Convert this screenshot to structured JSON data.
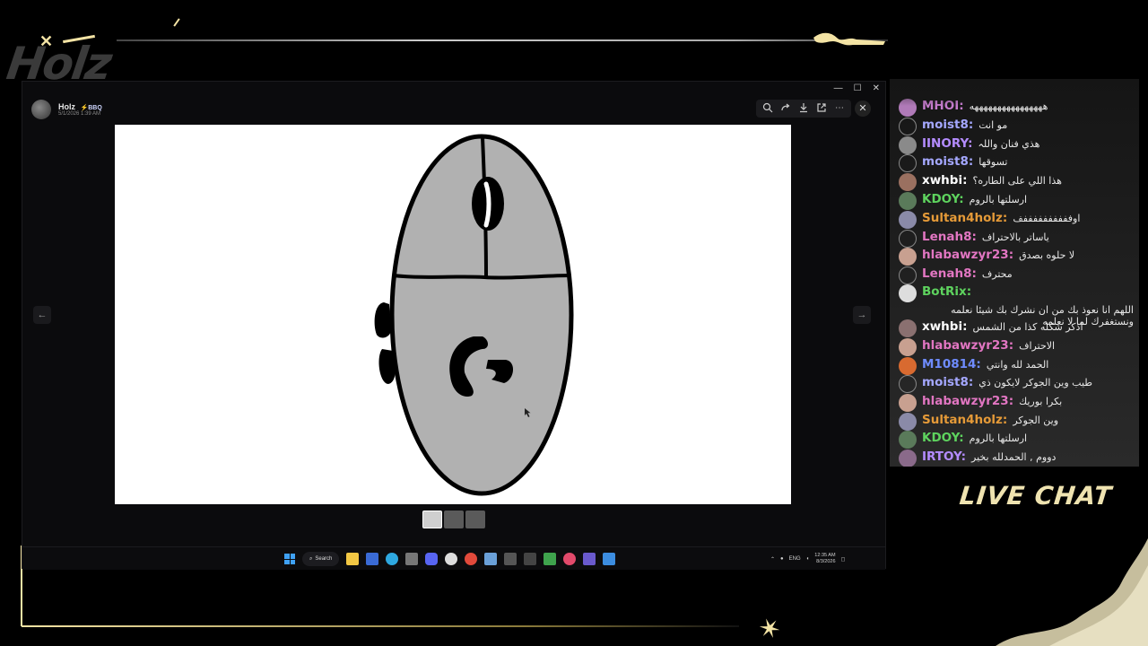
{
  "overlay": {
    "logo_text": "Holz",
    "live_chat_label": "LIVE CHAT",
    "accent_color": "#f3e3a4"
  },
  "window_controls": [
    "—",
    "☐",
    "✕"
  ],
  "viewer": {
    "author": "Holz",
    "author_badge": "⚡BBQ",
    "date": "5/1/2026 1:39 AM",
    "tools": [
      "zoom-in-icon",
      "forward-icon",
      "download-icon",
      "external-link-icon",
      "more-icon"
    ],
    "close_glyph": "✕",
    "prev_glyph": "←",
    "next_glyph": "→",
    "image_description": "hand-drawn computer mouse",
    "thumbnails": 3,
    "selected_thumbnail": 0
  },
  "taskbar": {
    "search_label": "Search",
    "language": "ENG",
    "time": "12:35 AM",
    "date": "8/3/2026"
  },
  "chat": {
    "messages": [
      {
        "user": "MHOI:",
        "color": "#c77dcf",
        "text": "ههههههههههههههههه"
      },
      {
        "user": "moist8:",
        "color": "#a4a7ff",
        "text": "مو انت"
      },
      {
        "user": "IINORY:",
        "color": "#b48cff",
        "text": "هذي فنان واللہ"
      },
      {
        "user": "moist8:",
        "color": "#a4a7ff",
        "text": "تسوقها"
      },
      {
        "user": "xwhbi:",
        "color": "#ffffff",
        "text": "هذا اللي على الطاره؟"
      },
      {
        "user": "KDOY:",
        "color": "#5ed35e",
        "text": "ارسلتها بالروم"
      },
      {
        "user": "Sultan4holz:",
        "color": "#e59a38",
        "text": "اوففففففففففف"
      },
      {
        "user": "Lenah8:",
        "color": "#e276c2",
        "text": "ياساتر بالاحتراف"
      },
      {
        "user": "hlabawzyr23:",
        "color": "#e276c2",
        "text": "لا حلوه بصدق"
      },
      {
        "user": "Lenah8:",
        "color": "#e276c2",
        "text": "محترف"
      },
      {
        "user": "BotRix:",
        "color": "#5ed35e",
        "text": "اللهم انا نعوذ بك من ان نشرك بك شيئا نعلمه ونستغفرك لما لا نعلمه"
      },
      {
        "user": "xwhbi:",
        "color": "#ffffff",
        "text": "اذكر شكله كذا من الشمس"
      },
      {
        "user": "hlabawzyr23:",
        "color": "#e276c2",
        "text": "الاحتراف"
      },
      {
        "user": "M10814:",
        "color": "#6f8cff",
        "text": "الحمد لله وانتي"
      },
      {
        "user": "moist8:",
        "color": "#a4a7ff",
        "text": "طيب وين الجوكر لايكون ذي"
      },
      {
        "user": "hlabawzyr23:",
        "color": "#e276c2",
        "text": "بكرا بوريك"
      },
      {
        "user": "Sultan4holz:",
        "color": "#e59a38",
        "text": "وين الجوكر"
      },
      {
        "user": "KDOY:",
        "color": "#5ed35e",
        "text": "ارسلتها بالروم"
      },
      {
        "user": "IRTOY:",
        "color": "#b48cff",
        "text": "دووم , الحمدلله بخير"
      }
    ]
  }
}
